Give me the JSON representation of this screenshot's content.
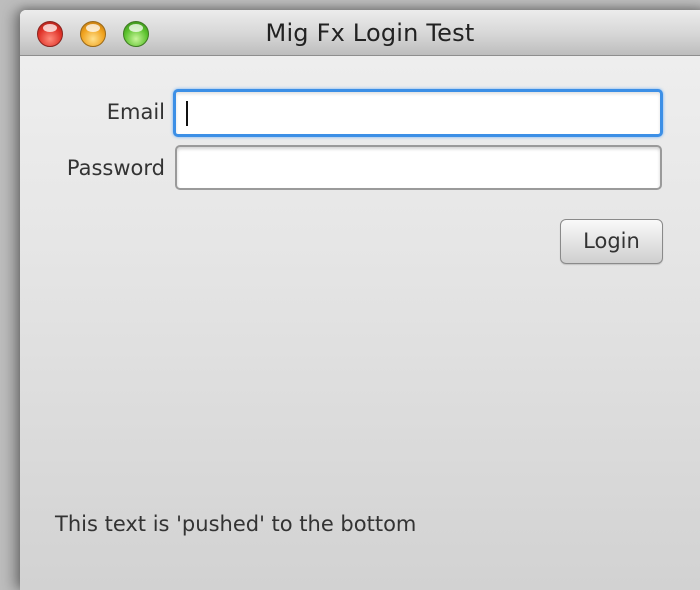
{
  "window": {
    "title": "Mig Fx Login Test"
  },
  "form": {
    "email_label": "Email",
    "email_value": "",
    "password_label": "Password",
    "password_value": "",
    "login_label": "Login"
  },
  "footer": {
    "text": "This text is 'pushed' to the bottom"
  },
  "colors": {
    "focus_ring": "#3c8fe6",
    "close_button": "#e0342a",
    "minimize_button": "#f0a21e",
    "zoom_button": "#5cc22e"
  }
}
